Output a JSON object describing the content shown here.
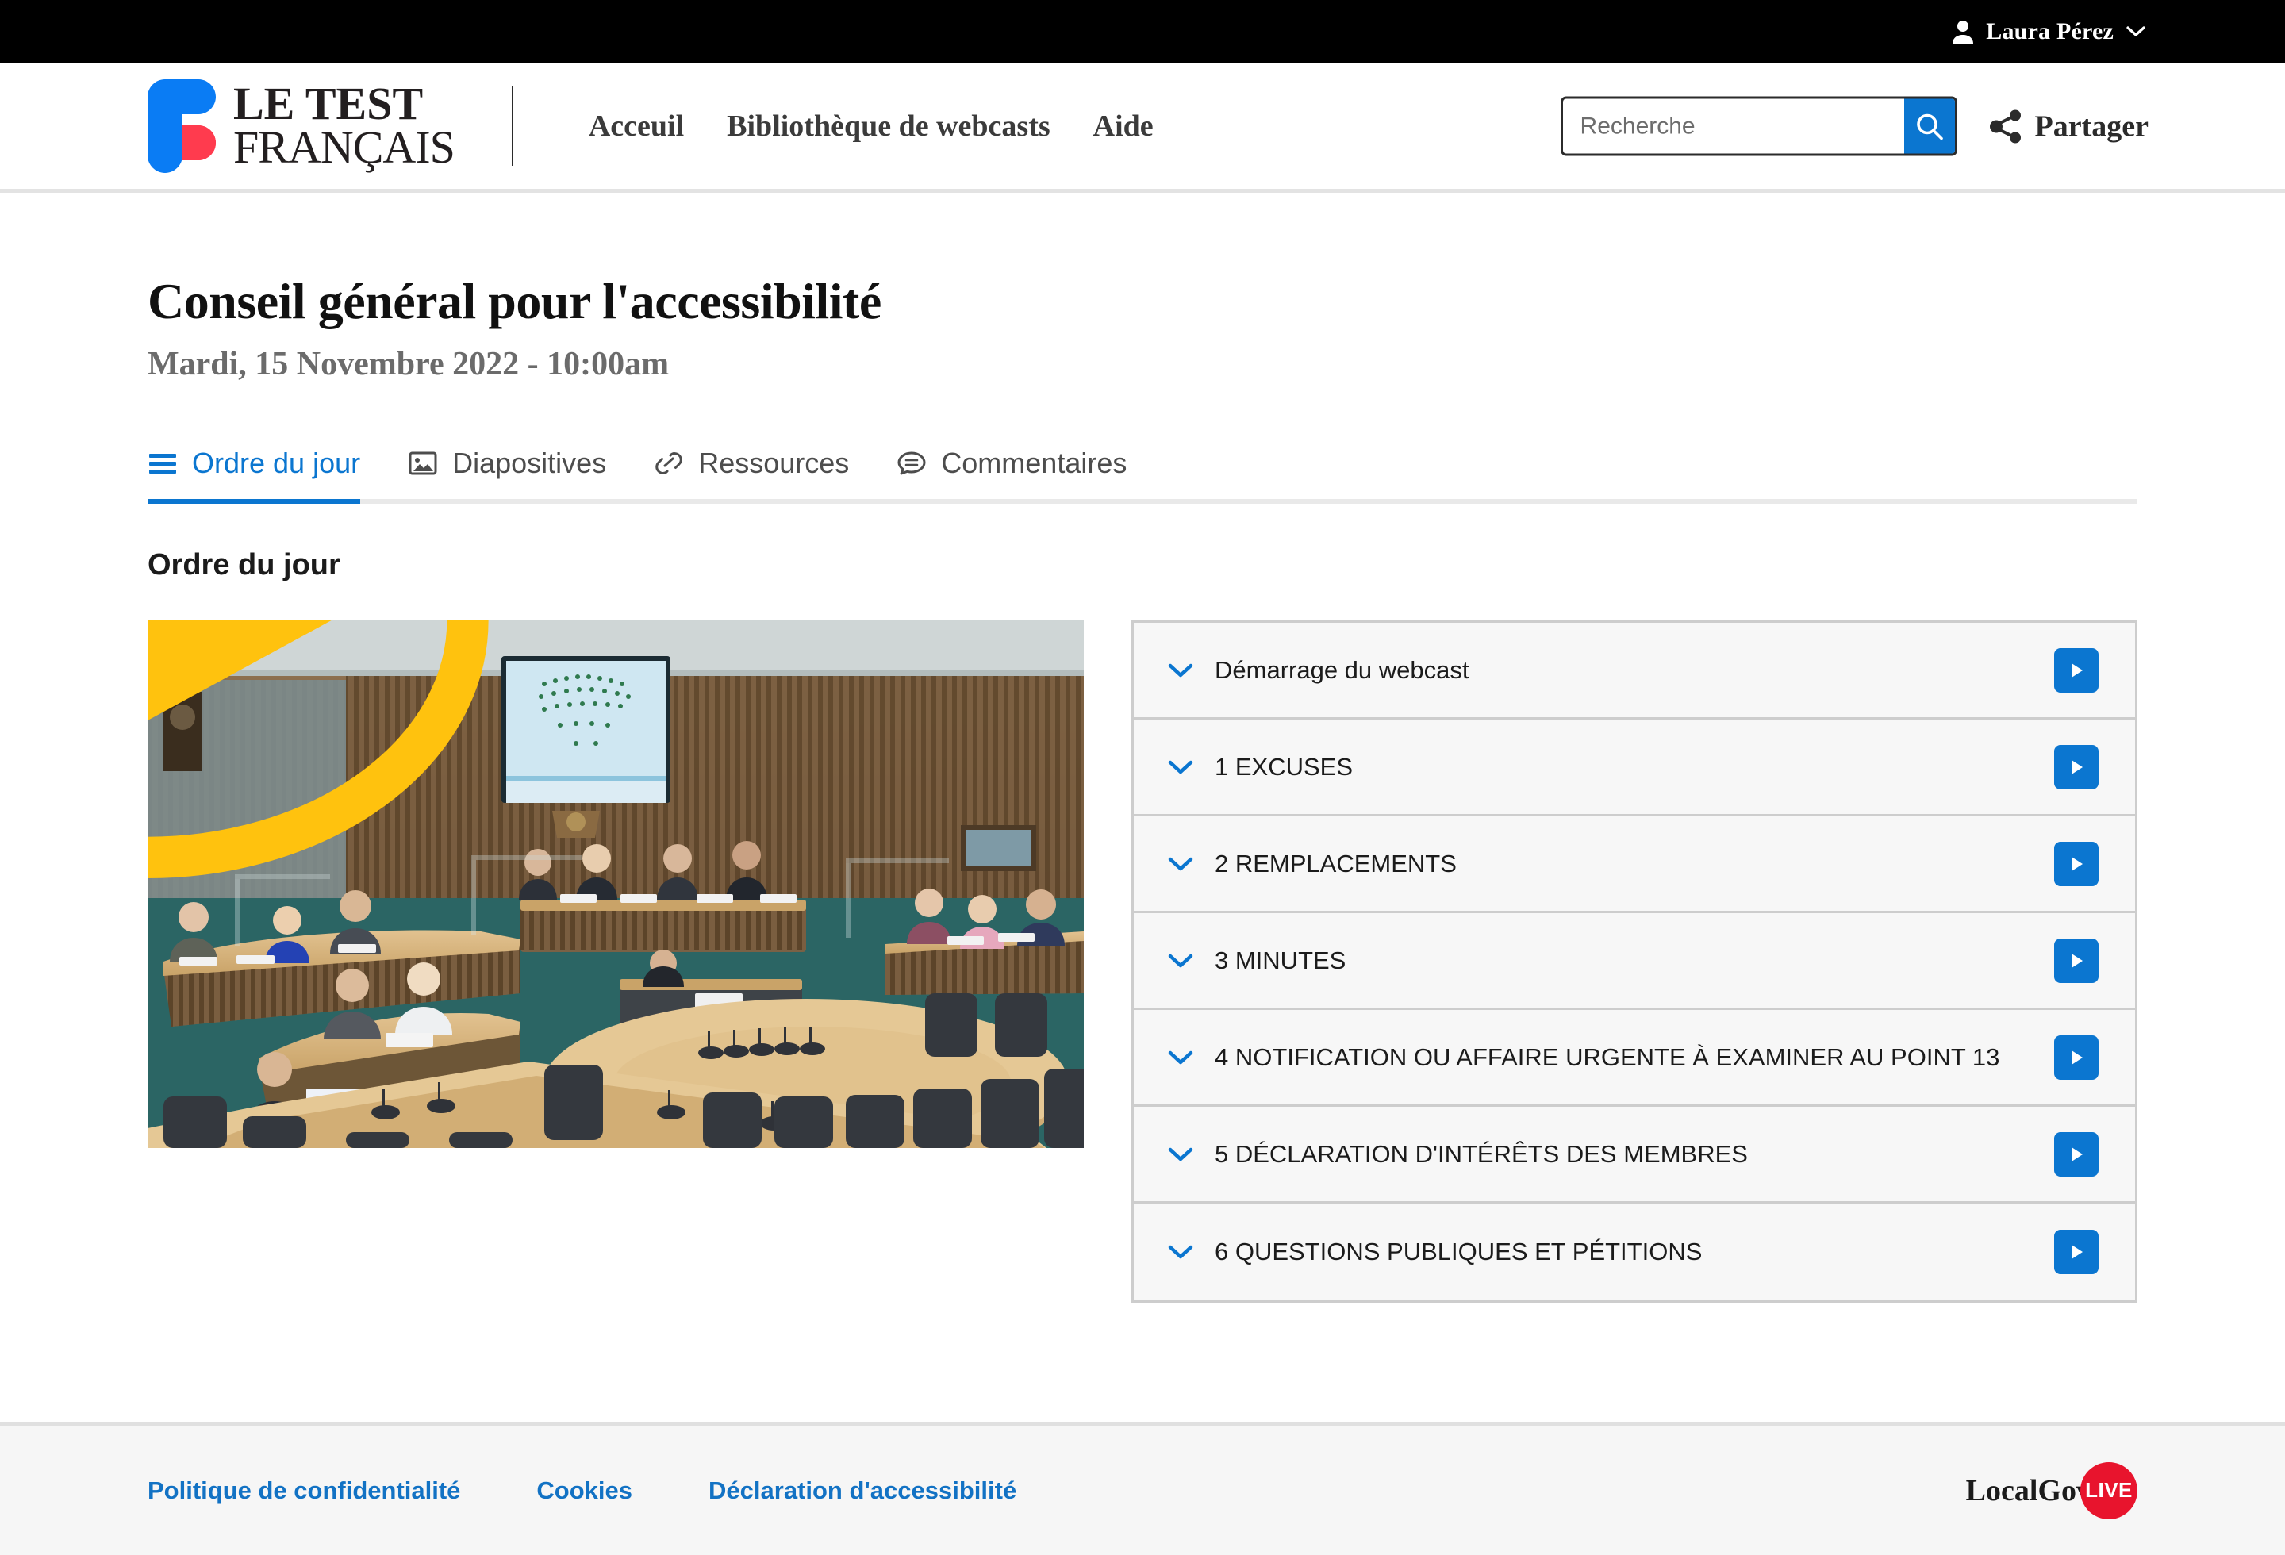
{
  "topbar": {
    "user_name": "Laura Pérez",
    "user_icon": "user-icon",
    "chevron_icon": "chevron-down-icon"
  },
  "header": {
    "logo_line1": "LE TEST",
    "logo_line2": "FRANÇAIS",
    "nav": [
      {
        "label": "Acceuil"
      },
      {
        "label": "Bibliothèque de webcasts"
      },
      {
        "label": "Aide"
      }
    ],
    "search": {
      "value": "",
      "placeholder": "Recherche",
      "button_icon": "search-icon"
    },
    "share": {
      "label": "Partager",
      "icon": "share-icon"
    }
  },
  "page": {
    "title": "Conseil général pour l'accessibilité",
    "subtitle": "Mardi, 15 Novembre 2022 - 10:00am"
  },
  "tabs": [
    {
      "label": "Ordre du jour",
      "icon": "list-icon",
      "active": true
    },
    {
      "label": "Diapositives",
      "icon": "image-icon",
      "active": false
    },
    {
      "label": "Ressources",
      "icon": "link-icon",
      "active": false
    },
    {
      "label": "Commentaires",
      "icon": "comment-icon",
      "active": false
    }
  ],
  "section": {
    "title": "Ordre du jour"
  },
  "player": {
    "play_icon": "play-circle-icon",
    "alt": "Council chamber webcast thumbnail"
  },
  "agenda": {
    "items": [
      {
        "label": "Démarrage du webcast",
        "chevron": "chevron-down-icon",
        "play": "play-icon"
      },
      {
        "label": "1 EXCUSES",
        "chevron": "chevron-down-icon",
        "play": "play-icon"
      },
      {
        "label": "2 REMPLACEMENTS",
        "chevron": "chevron-down-icon",
        "play": "play-icon"
      },
      {
        "label": "3 MINUTES",
        "chevron": "chevron-down-icon",
        "play": "play-icon"
      },
      {
        "label": "4 NOTIFICATION OU AFFAIRE URGENTE À EXAMINER AU POINT 13",
        "chevron": "chevron-down-icon",
        "play": "play-icon"
      },
      {
        "label": "5 DÉCLARATION D'INTÉRÊTS DES MEMBRES",
        "chevron": "chevron-down-icon",
        "play": "play-icon"
      },
      {
        "label": "6 QUESTIONS PUBLIQUES ET PÉTITIONS",
        "chevron": "chevron-down-icon",
        "play": "play-icon"
      }
    ]
  },
  "footer": {
    "links": [
      {
        "label": "Politique de confidentialité"
      },
      {
        "label": "Cookies"
      },
      {
        "label": "Déclaration d'accessibilité"
      }
    ],
    "logo_text": "LocalGov",
    "logo_badge": "LIVE"
  },
  "colors": {
    "accent_blue": "#0b76d0",
    "link_blue": "#1272c4",
    "play_yellow": "#ffc20e",
    "brand_red": "#e8142d",
    "brand_blue": "#0a7cf4",
    "topbar_black": "#000000",
    "footer_bg": "#f6f6f6",
    "panel_bg": "#f7f7f7",
    "panel_border": "#cdcdcd"
  }
}
